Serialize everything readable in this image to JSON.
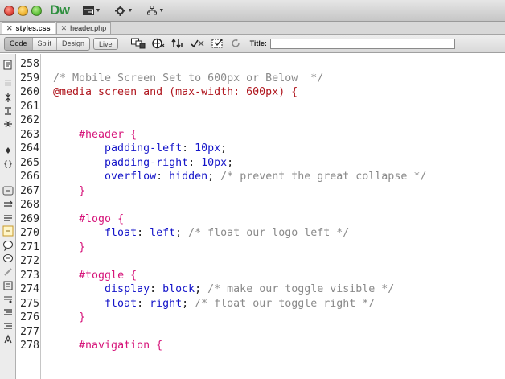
{
  "app": {
    "logo": "Dw",
    "colors": {
      "logo": "#2f8f3f",
      "selector": "#d6157a",
      "at_rule": "#b0171f",
      "property": "#1515c9",
      "comment": "#8a8a8a"
    }
  },
  "titlebar": {
    "menus": [
      {
        "icon": "layout-icon"
      },
      {
        "icon": "gear-icon"
      },
      {
        "icon": "site-icon"
      }
    ]
  },
  "tabs": [
    {
      "label": "styles.css",
      "active": true
    },
    {
      "label": "header.php",
      "active": false
    }
  ],
  "doc_toolbar": {
    "views": [
      "Code",
      "Split",
      "Design"
    ],
    "live": "Live",
    "title_label": "Title:",
    "title_value": ""
  },
  "code_lines": [
    {
      "num": "258",
      "tokens": []
    },
    {
      "num": "259",
      "tokens": [
        {
          "t": "/* Mobile Screen Set to 600px or Below  */",
          "c": "comment"
        }
      ]
    },
    {
      "num": "260",
      "tokens": [
        {
          "t": "@media screen and (max-width: 600px) {",
          "c": "at"
        }
      ]
    },
    {
      "num": "261",
      "tokens": []
    },
    {
      "num": "262",
      "tokens": []
    },
    {
      "num": "263",
      "tokens": [
        {
          "t": "    ",
          "c": "punct"
        },
        {
          "t": "#header",
          "c": "sel"
        },
        {
          "t": " {",
          "c": "brace"
        }
      ]
    },
    {
      "num": "264",
      "tokens": [
        {
          "t": "        ",
          "c": "punct"
        },
        {
          "t": "padding-left",
          "c": "prop"
        },
        {
          "t": ": ",
          "c": "punct"
        },
        {
          "t": "10px",
          "c": "val"
        },
        {
          "t": ";",
          "c": "punct"
        }
      ]
    },
    {
      "num": "265",
      "tokens": [
        {
          "t": "        ",
          "c": "punct"
        },
        {
          "t": "padding-right",
          "c": "prop"
        },
        {
          "t": ": ",
          "c": "punct"
        },
        {
          "t": "10px",
          "c": "val"
        },
        {
          "t": ";",
          "c": "punct"
        }
      ]
    },
    {
      "num": "266",
      "tokens": [
        {
          "t": "        ",
          "c": "punct"
        },
        {
          "t": "overflow",
          "c": "prop"
        },
        {
          "t": ": ",
          "c": "punct"
        },
        {
          "t": "hidden",
          "c": "val"
        },
        {
          "t": "; ",
          "c": "punct"
        },
        {
          "t": "/* prevent the great collapse */",
          "c": "comment"
        }
      ]
    },
    {
      "num": "267",
      "tokens": [
        {
          "t": "    ",
          "c": "punct"
        },
        {
          "t": "}",
          "c": "brace"
        }
      ]
    },
    {
      "num": "268",
      "tokens": []
    },
    {
      "num": "269",
      "tokens": [
        {
          "t": "    ",
          "c": "punct"
        },
        {
          "t": "#logo",
          "c": "sel"
        },
        {
          "t": " {",
          "c": "brace"
        }
      ]
    },
    {
      "num": "270",
      "tokens": [
        {
          "t": "        ",
          "c": "punct"
        },
        {
          "t": "float",
          "c": "prop"
        },
        {
          "t": ": ",
          "c": "punct"
        },
        {
          "t": "left",
          "c": "val"
        },
        {
          "t": "; ",
          "c": "punct"
        },
        {
          "t": "/* float our logo left */",
          "c": "comment"
        }
      ]
    },
    {
      "num": "271",
      "tokens": [
        {
          "t": "    ",
          "c": "punct"
        },
        {
          "t": "}",
          "c": "brace"
        }
      ]
    },
    {
      "num": "272",
      "tokens": []
    },
    {
      "num": "273",
      "tokens": [
        {
          "t": "    ",
          "c": "punct"
        },
        {
          "t": "#toggle",
          "c": "sel"
        },
        {
          "t": " {",
          "c": "brace"
        }
      ]
    },
    {
      "num": "274",
      "tokens": [
        {
          "t": "        ",
          "c": "punct"
        },
        {
          "t": "display",
          "c": "prop"
        },
        {
          "t": ": ",
          "c": "punct"
        },
        {
          "t": "block",
          "c": "val"
        },
        {
          "t": "; ",
          "c": "punct"
        },
        {
          "t": "/* make our toggle visible */",
          "c": "comment"
        }
      ]
    },
    {
      "num": "275",
      "tokens": [
        {
          "t": "        ",
          "c": "punct"
        },
        {
          "t": "float",
          "c": "prop"
        },
        {
          "t": ": ",
          "c": "punct"
        },
        {
          "t": "right",
          "c": "val"
        },
        {
          "t": "; ",
          "c": "punct"
        },
        {
          "t": "/* float our toggle right */",
          "c": "comment"
        }
      ]
    },
    {
      "num": "276",
      "tokens": [
        {
          "t": "    ",
          "c": "punct"
        },
        {
          "t": "}",
          "c": "brace"
        }
      ]
    },
    {
      "num": "277",
      "tokens": []
    },
    {
      "num": "278",
      "tokens": [
        {
          "t": "    ",
          "c": "punct"
        },
        {
          "t": "#navigation",
          "c": "sel"
        },
        {
          "t": " {",
          "c": "brace"
        }
      ]
    }
  ],
  "coding_tools": [
    "open-documents-icon",
    "collapse-icon",
    "expand-all-icon",
    "select-parent-icon",
    "balance-braces-icon",
    "line-numbers-icon",
    "highlight-invalid-icon",
    "word-wrap-icon",
    "syntax-error-icon",
    "apply-comment-icon",
    "remove-comment-icon",
    "wrap-tag-icon",
    "recent-snippets-icon",
    "move-css-icon",
    "indent-icon",
    "outdent-icon",
    "format-source-icon"
  ]
}
